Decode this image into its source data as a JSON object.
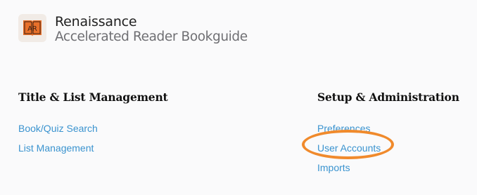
{
  "header": {
    "brand_name": "Renaissance",
    "product_name": "Accelerated Reader Bookguide",
    "logo_text": "AR",
    "logo_color": "#e8702a"
  },
  "left_section": {
    "title": "Title & List Management",
    "links": [
      {
        "label": "Book/Quiz Search"
      },
      {
        "label": "List Management"
      }
    ]
  },
  "right_section": {
    "title": "Setup & Administration",
    "links": [
      {
        "label": "Preferences"
      },
      {
        "label": "User Accounts"
      },
      {
        "label": "Imports"
      }
    ]
  },
  "colors": {
    "link": "#3a93cf",
    "highlight": "#f08a2c",
    "background": "#fafafb"
  }
}
